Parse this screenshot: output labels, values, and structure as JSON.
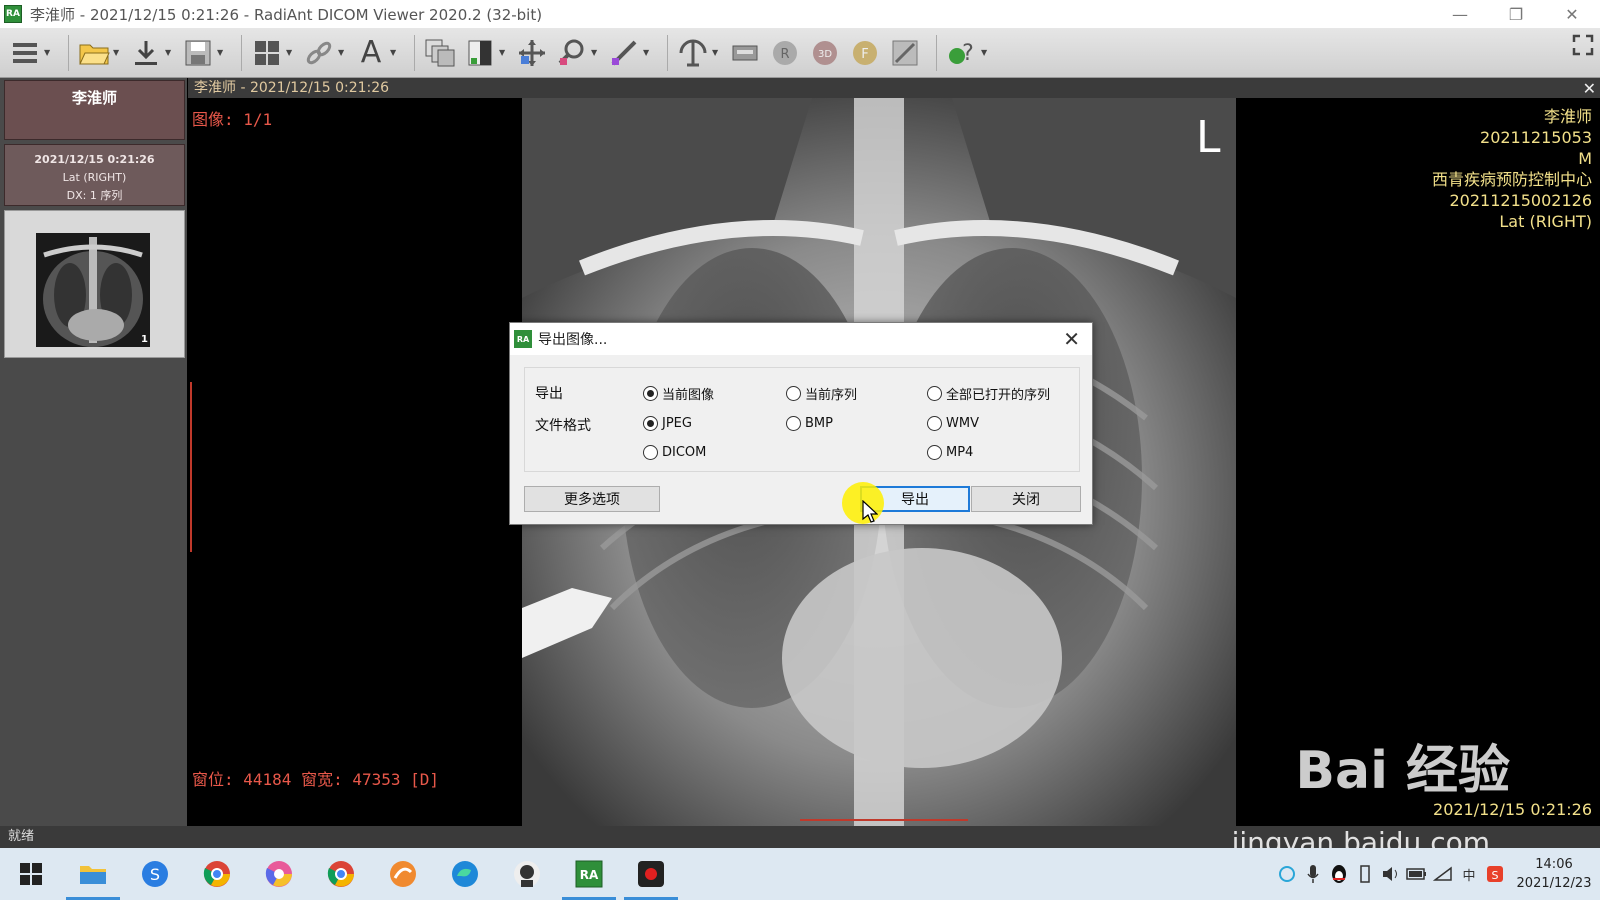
{
  "window": {
    "title": "李淮师 - 2021/12/15 0:21:26 - RadiAnt DICOM Viewer 2020.2 (32-bit)",
    "app_icon": "RA"
  },
  "patient_panel": {
    "patient_name": "李淮师",
    "study_date": "2021/12/15 0:21:26",
    "study_desc": "Lat (RIGHT)",
    "study_series": "DX: 1 序列",
    "thumbnail_count": "1"
  },
  "viewer": {
    "header": "李淮师  - 2021/12/15 0:21:26",
    "image_index": "图像: 1/1",
    "window_level": "窗位: 44184 窗宽: 47353 [D]",
    "marker": "L",
    "info_right": [
      "李淮师",
      "20211215053",
      "M",
      "西青疾病预防控制中心",
      "20211215002126",
      "Lat (RIGHT)"
    ],
    "bottom_right_date": "2021/12/15 0:21:26"
  },
  "dialog": {
    "title": "导出图像...",
    "icon": "RA",
    "export_label": "导出",
    "format_label": "文件格式",
    "export_options": [
      {
        "label": "当前图像",
        "checked": true
      },
      {
        "label": "当前序列",
        "checked": false
      },
      {
        "label": "全部已打开的序列",
        "checked": false
      }
    ],
    "format_options": [
      {
        "label": "JPEG",
        "checked": true
      },
      {
        "label": "BMP",
        "checked": false
      },
      {
        "label": "WMV",
        "checked": false
      },
      {
        "label": "DICOM",
        "checked": false
      },
      {
        "label": "MP4",
        "checked": false
      }
    ],
    "more_options_button": "更多选项",
    "export_button": "导出",
    "close_button": "关闭"
  },
  "statusbar": {
    "text": "就绪"
  },
  "taskbar": {
    "time": "14:06",
    "date": "2021/12/23",
    "ime": "中"
  },
  "watermark": {
    "text": "Bai 经验",
    "url": "jingyan.baidu.com"
  },
  "colors": {
    "overlay_red": "#e8584a",
    "overlay_yellow": "#f2e08a",
    "accent_blue": "#1e7ad8",
    "patient_header_bg": "#6b4f50"
  }
}
